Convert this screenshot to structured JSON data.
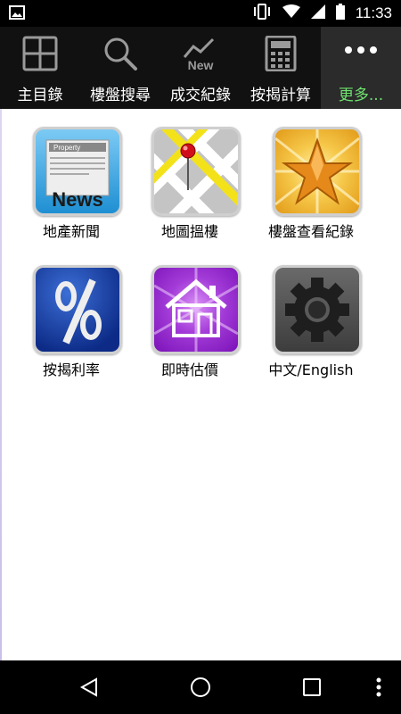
{
  "status": {
    "time": "11:33",
    "icons": [
      "image-notification-icon",
      "vibrate-icon",
      "wifi-icon",
      "signal-icon",
      "battery-icon"
    ]
  },
  "tabs": [
    {
      "label": "主目錄",
      "icon": "grid-icon",
      "active": false
    },
    {
      "label": "樓盤搜尋",
      "icon": "search-icon",
      "active": false
    },
    {
      "label": "成交紀錄",
      "icon": "new-chart-icon",
      "active": false,
      "icon_text": "New"
    },
    {
      "label": "按揭計算",
      "icon": "calculator-icon",
      "active": false
    },
    {
      "label": "更多...",
      "icon": "more-dots-icon",
      "active": true
    }
  ],
  "apps": [
    {
      "label": "地產新聞",
      "icon": "news-icon",
      "icon_text": "News",
      "icon_subtext": "Property"
    },
    {
      "label": "地圖搵樓",
      "icon": "map-pin-icon"
    },
    {
      "label": "樓盤查看紀錄",
      "icon": "star-icon"
    },
    {
      "label": "按揭利率",
      "icon": "percent-icon"
    },
    {
      "label": "即時估價",
      "icon": "house-icon"
    },
    {
      "label": "中文/English",
      "icon": "gear-icon"
    }
  ],
  "colors": {
    "active_tab_label": "#6fe36f",
    "nav_background": "#111111",
    "content_background": "#ffffff"
  }
}
